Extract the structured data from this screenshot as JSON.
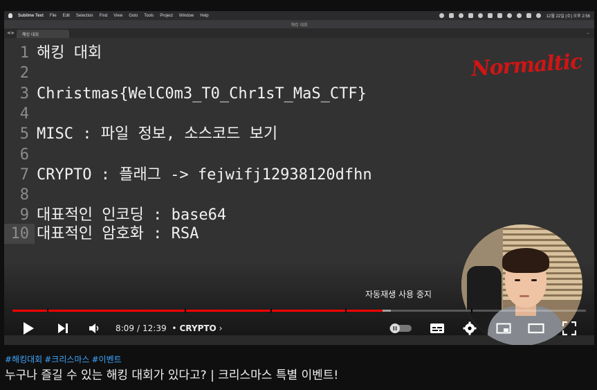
{
  "menubar": {
    "app_name": "Sublime Text",
    "items": [
      "File",
      "Edit",
      "Selection",
      "Find",
      "View",
      "Goto",
      "Tools",
      "Project",
      "Window",
      "Help"
    ],
    "clock": "12월 22일 (수) 오후 2:56"
  },
  "window": {
    "title": "해킹 대회"
  },
  "tab": {
    "label": "해킹 대회"
  },
  "editor": {
    "lines": [
      {
        "num": "1",
        "text": "해킹 대회"
      },
      {
        "num": "2",
        "text": ""
      },
      {
        "num": "3",
        "text": "Christmas{WelC0m3_T0_Chr1sT_MaS_CTF}"
      },
      {
        "num": "4",
        "text": ""
      },
      {
        "num": "5",
        "text": "MISC : 파일 정보, 소스코드 보기"
      },
      {
        "num": "6",
        "text": ""
      },
      {
        "num": "7",
        "text": "CRYPTO : 플래그 -> fejwifj12938120dfhn"
      },
      {
        "num": "8",
        "text": ""
      },
      {
        "num": "9",
        "text": "대표적인 인코딩 : base64"
      },
      {
        "num": "10",
        "text": "대표적인 암호화 : RSA"
      }
    ],
    "current_line": 10
  },
  "watermark": "Normaltic",
  "player": {
    "autoplay_tooltip": "자동재생 사용 중지",
    "current_time": "8:09",
    "duration": "12:39",
    "time_separator": "/",
    "chapter": "CRYPTO",
    "chapter_bullet": "•",
    "progress_played_fraction": 0.645,
    "progress_buffered_fraction": 0.66,
    "chapter_marks": [
      0.06,
      0.3,
      0.45,
      0.58,
      0.8
    ],
    "accent_color": "#ff0000",
    "icons": [
      "play-icon",
      "next-icon",
      "volume-icon",
      "autoplay-toggle-icon",
      "subtitles-icon",
      "settings-icon",
      "miniplayer-icon",
      "theater-icon",
      "fullscreen-icon"
    ]
  },
  "video": {
    "hashtags": [
      "#해킹대회",
      "#크리스마스",
      "#이벤트"
    ],
    "title": "누구나 즐길 수 있는 해킹 대회가 있다고? | 크리스마스 특별 이벤트!"
  }
}
